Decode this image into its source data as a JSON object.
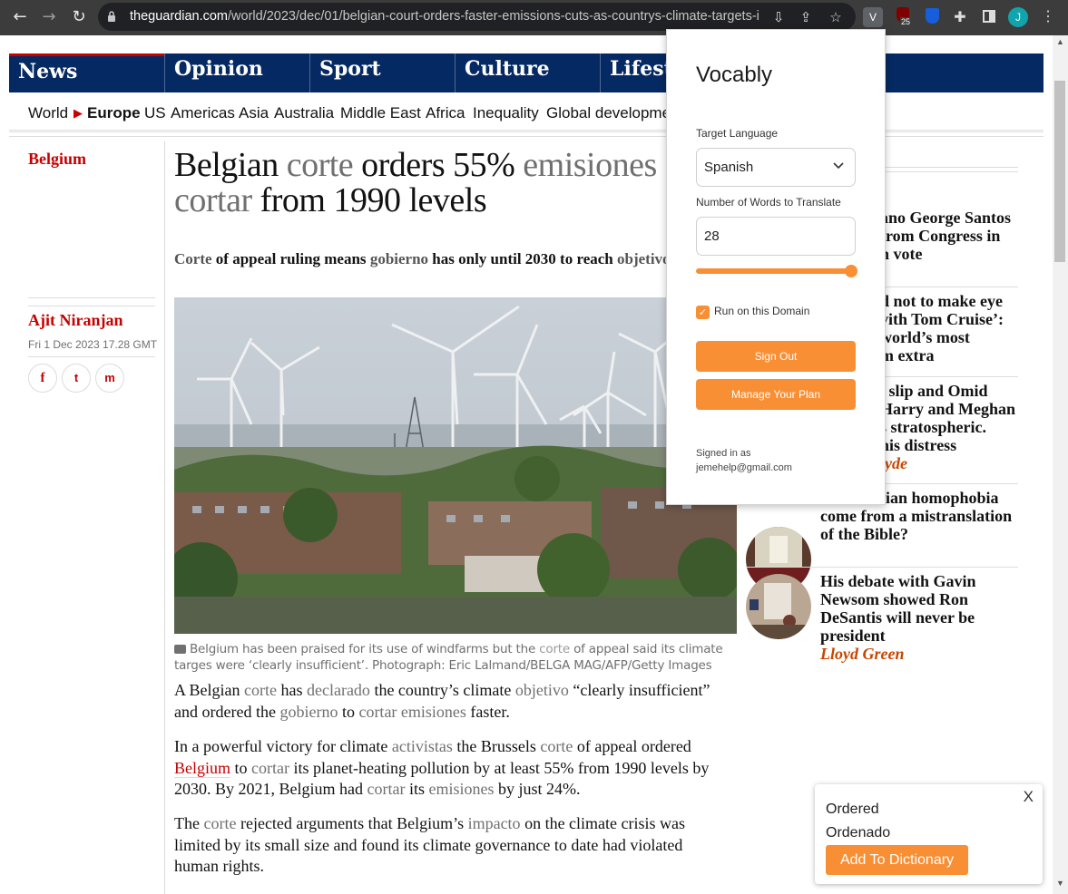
{
  "browser": {
    "url_host": "theguardian.com",
    "url_path": "/world/2023/dec/01/belgian-court-orders-faster-emissions-cuts-as-countrys-climate-targets-i...",
    "ext_badge": "25",
    "profile_initial": "J",
    "vocably_ext_initial": "V"
  },
  "nav": {
    "pillars": [
      "News",
      "Opinion",
      "Sport",
      "Culture",
      "Lifesty"
    ],
    "sub": [
      "World",
      "Europe",
      "US",
      "Americas",
      "Asia",
      "Australia",
      "Middle East",
      "Africa",
      "Inequality",
      "Global developmen"
    ]
  },
  "article": {
    "kicker": "Belgium",
    "headline": [
      "Belgian ",
      "corte",
      " orders 55% ",
      "emisiones",
      " ",
      "cortar",
      " from 1990 levels"
    ],
    "standfirst": [
      "Corte",
      " of appeal ruling means ",
      "gobierno",
      " has only until 2030 to reach ",
      "objetivo"
    ],
    "author": "Ajit Niranjan",
    "date": "Fri 1 Dec 2023 17.28 GMT",
    "share": [
      "f",
      "t",
      "m"
    ],
    "caption": [
      "Belgium has been praised for its use of windfarms but the ",
      "corte",
      " of appeal said its climate targes were ‘clearly insufficient’. Photograph: Eric Lalmand/BELGA MAG/AFP/Getty Images"
    ],
    "p1": [
      "A Belgian ",
      "corte",
      " has ",
      "declarado",
      " the country’s climate ",
      "objetivo",
      " “clearly insufficient” and ordered the ",
      "gobierno",
      " to ",
      "cortar",
      " ",
      "emisiones",
      " faster."
    ],
    "p2": [
      "In a powerful victory for climate ",
      "activistas",
      " the Brussels ",
      "corte",
      " of appeal ordered ",
      "Belgium",
      " to ",
      "cortar",
      " its planet-heating pollution by at least 55% from 1990 levels by 2030. By 2021, Belgium had ",
      "cortar",
      " its ",
      "emisiones",
      " by just 24%."
    ],
    "p3": [
      "The ",
      "corte",
      " rejected arguments that Belgium’s ",
      "impacto",
      " on the climate crisis was limited by its small size and found its climate governance to date had violated human rights."
    ]
  },
  "sidebar": {
    "items": [
      {
        "lines": [
          "ano George Santos",
          "from Congress in",
          "n vote"
        ]
      },
      {
        "lines": [
          "d not to make eye",
          "vith Tom Cruise’:",
          "world’s most",
          "m extra"
        ]
      },
      {
        "lines": [
          "l slip and Omid",
          "Harry and Meghan",
          "s stratospheric.",
          "his distress"
        ],
        "author": "lyde"
      },
      {
        "lines": [
          "tian homophobia",
          "come from a mistranslation",
          "of the Bible?"
        ]
      },
      {
        "lines": [
          "His debate with Gavin",
          "Newsom showed Ron",
          "DeSantis will never be",
          "president"
        ],
        "author": "Lloyd Green"
      }
    ]
  },
  "vocably": {
    "title": "Vocably",
    "target_language_label": "Target Language",
    "target_language": "Spanish",
    "words_label": "Number of Words to Translate",
    "words_value": "28",
    "slider_fraction": 1.0,
    "run_on_domain": "Run on this Domain",
    "run_on_domain_checked": true,
    "sign_out": "Sign Out",
    "manage_plan": "Manage Your Plan",
    "signed_in_as": "Signed in as",
    "email": "jemehelp@gmail.com",
    "accent": "#f98f35"
  },
  "tooltip": {
    "word": "Ordered",
    "translation": "Ordenado",
    "button": "Add To Dictionary",
    "close": "X"
  }
}
